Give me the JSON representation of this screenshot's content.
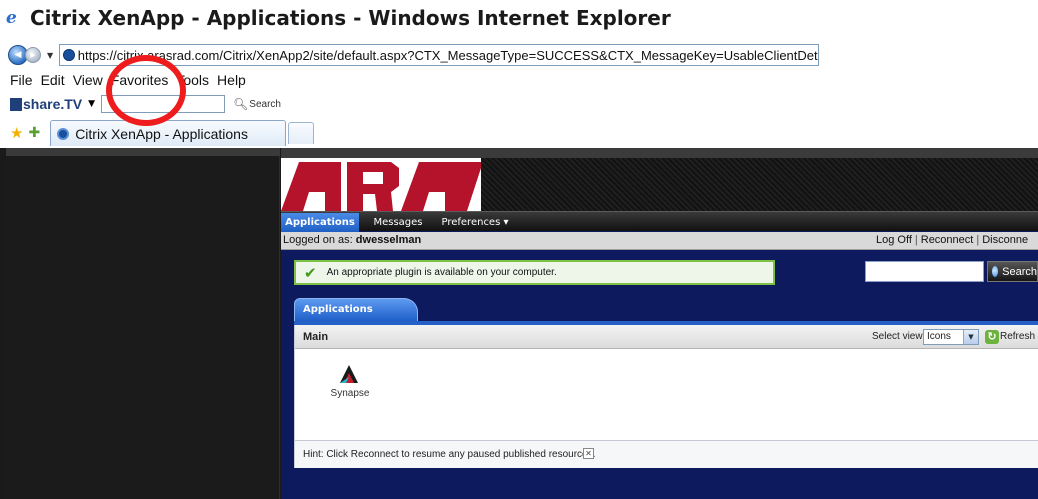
{
  "window": {
    "title": "Citrix XenApp - Applications - Windows Internet Explorer",
    "ie_logo_glyph": "e"
  },
  "address_bar": {
    "back_glyph": "◀",
    "forward_glyph": "▶",
    "dropdown_glyph": "▼",
    "url": "https://citrix.arasrad.com/Citrix/XenApp2/site/default.aspx?CTX_MessageType=SUCCESS&CTX_MessageKey=UsableClientDetected"
  },
  "menu": {
    "items": [
      "File",
      "Edit",
      "View",
      "Favorites",
      "Tools",
      "Help"
    ]
  },
  "sharetv": {
    "logo_text": "share.TV",
    "dropdown_glyph": "▼",
    "search_label": "Search"
  },
  "favorites_bar": {
    "star_icon": "★",
    "add_icon": "✚",
    "tab_label": "Citrix XenApp - Applications"
  },
  "citrix": {
    "nav": {
      "applications": "Applications",
      "messages": "Messages",
      "preferences": "Preferences ▾"
    },
    "logon": {
      "prefix": "Logged on as: ",
      "user": "dwesselman",
      "log_off": "Log Off",
      "reconnect": "Reconnect",
      "disconnect": "Disconne",
      "separator": "|"
    },
    "plugin_message": "An appropriate plugin is available on your computer.",
    "check_icon": "✔",
    "search_button": "Search",
    "apps_tab": "Applications",
    "main_label": "Main",
    "select_view_label": "Select view:",
    "view_value": "Icons",
    "refresh_label": "Refresh",
    "app": {
      "name": "Synapse"
    },
    "hint": "Hint: Click Reconnect to resume any paused published resources.",
    "hint_close": "✕",
    "colors": {
      "nav_active": "#2a6ad6",
      "page_bg": "#0d1b5e",
      "plugin_border": "#7dc044",
      "logo_red": "#b5122b",
      "highlight": "#ee1c1c"
    }
  }
}
